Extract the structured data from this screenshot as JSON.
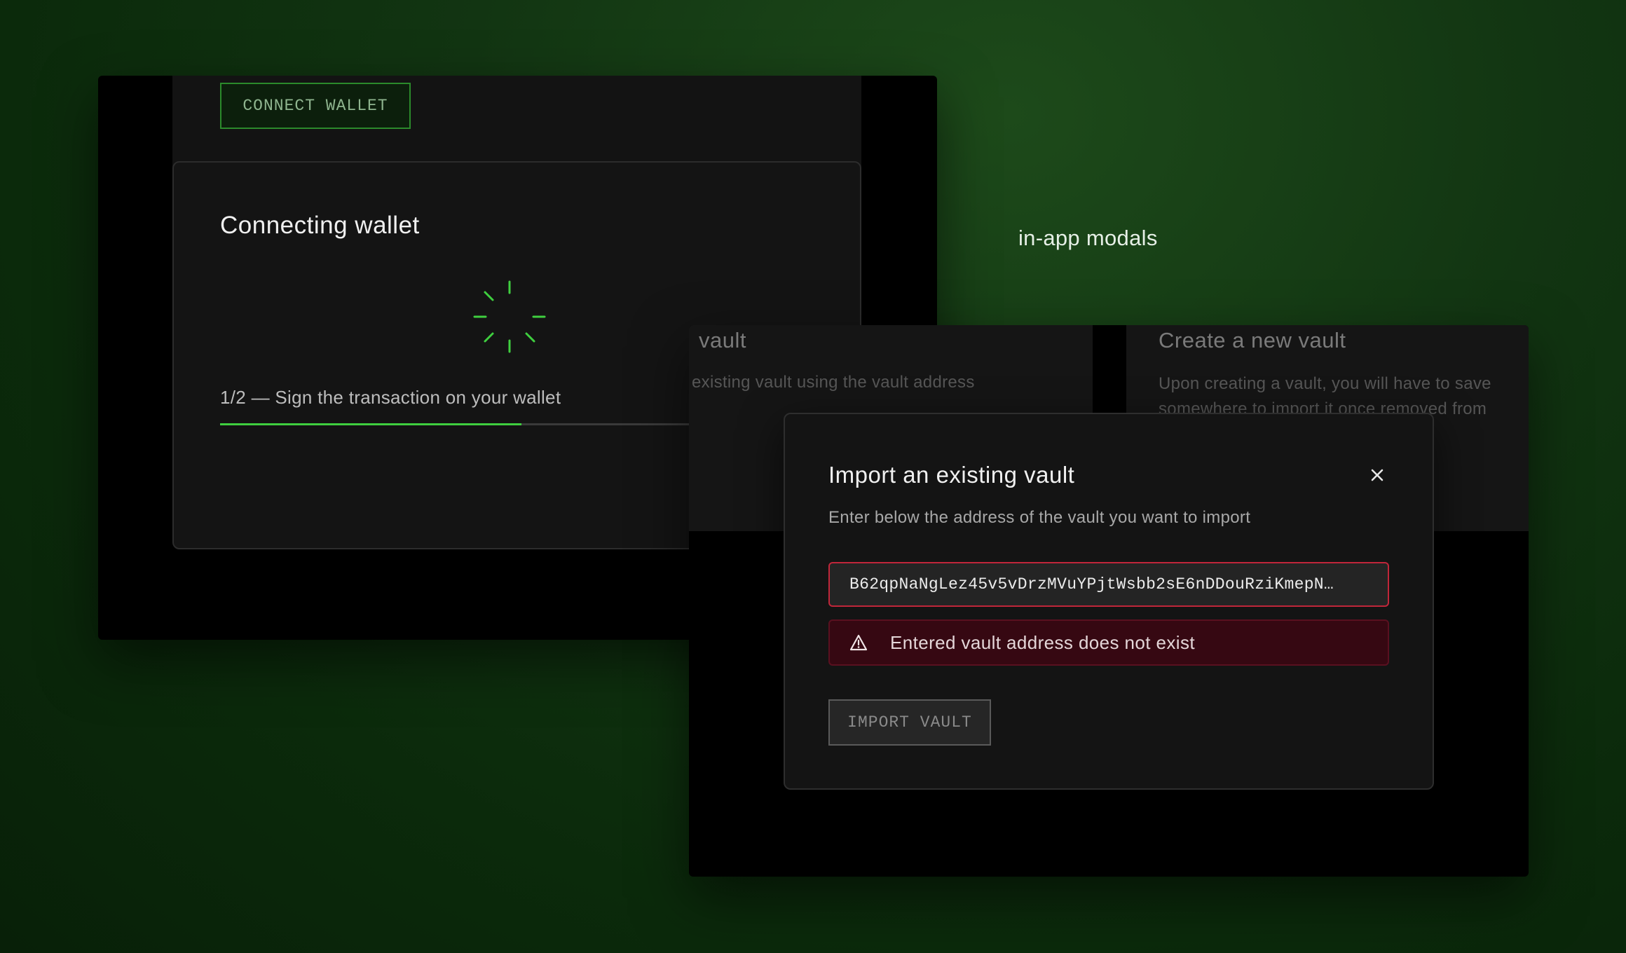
{
  "left_window": {
    "connect_button": "CONNECT WALLET",
    "modal": {
      "title": "Connecting wallet",
      "step_text": "1/2 — Sign the transaction on your wallet",
      "progress": 0.5
    }
  },
  "caption": "in-app modals",
  "right_window": {
    "import_card": {
      "title": "vault",
      "description": "existing vault using the vault address"
    },
    "create_card": {
      "title": "Create a new vault",
      "description_line1": "Upon creating a vault, you will have to save",
      "description_line2": "somewhere to import it once removed from"
    }
  },
  "import_modal": {
    "title": "Import an existing vault",
    "description": "Enter below the address of the vault you want to import",
    "address_value": "B62qpNaNgLez45v5vDrzMVuYPjtWsbb2sE6nDDouRziKmepN…",
    "error_message": "Entered vault address does not exist",
    "import_button": "IMPORT VAULT"
  },
  "colors": {
    "accent_green": "#3fcf3f",
    "error_red": "#c0263a",
    "error_bg": "#360812"
  },
  "icons": [
    "loading-spinner-icon",
    "close-icon",
    "warning-icon"
  ]
}
